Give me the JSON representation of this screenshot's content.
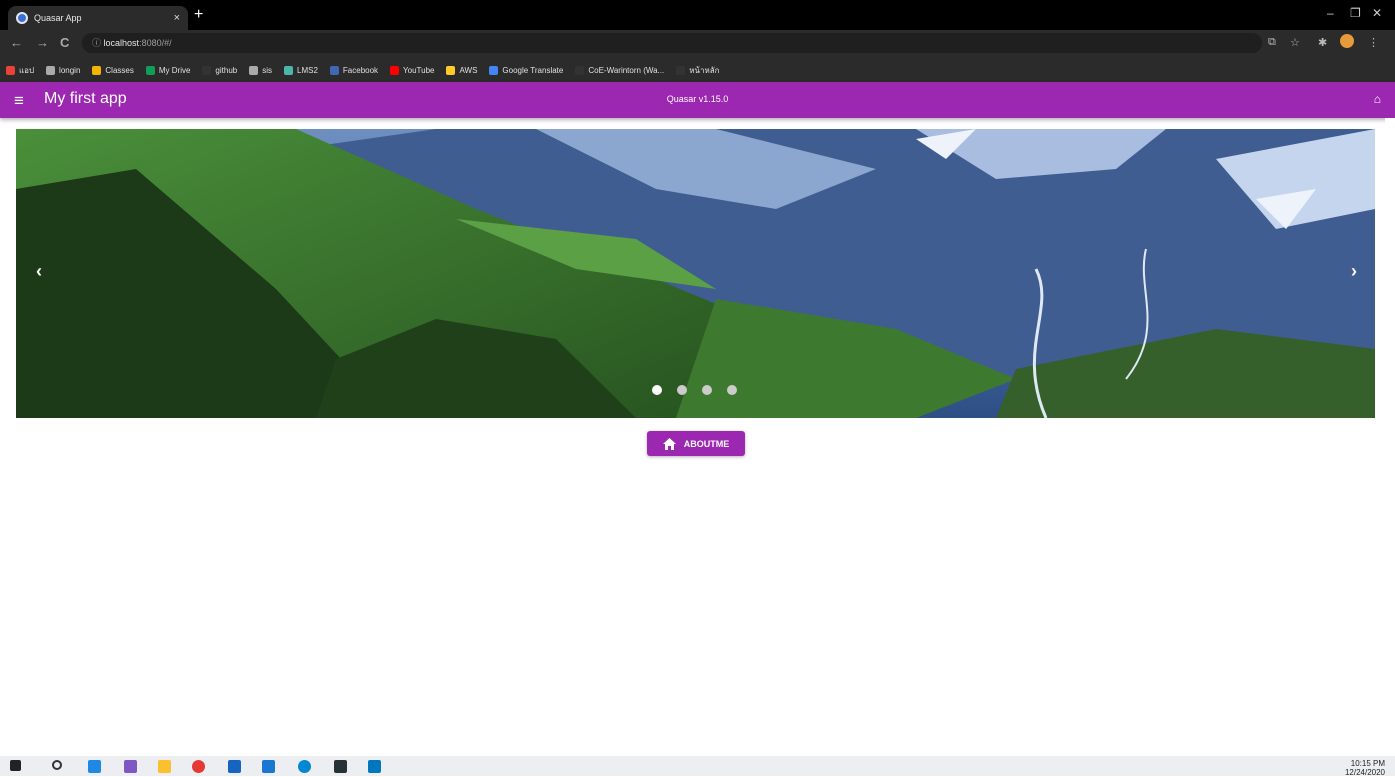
{
  "browser": {
    "tab_title": "Quasar App",
    "tab_close": "×",
    "new_tab": "+",
    "url_host": "localhost",
    "url_rest": ":8080/#/",
    "info": "ⓘ",
    "win_min": "–",
    "win_max": "❐",
    "win_close": "✕",
    "back": "←",
    "forward": "→",
    "reload": "C",
    "translate": "⧉",
    "star": "☆",
    "extensions": "✱",
    "more": "⋮",
    "bookmarks": [
      {
        "label": "แอป",
        "color": "#ea4335"
      },
      {
        "label": "longin",
        "color": "#aaaaaa"
      },
      {
        "label": "Classes",
        "color": "#f4b400"
      },
      {
        "label": "My Drive",
        "color": "#0f9d58"
      },
      {
        "label": "github",
        "color": "#333333"
      },
      {
        "label": "sis",
        "color": "#aaaaaa"
      },
      {
        "label": "LMS2",
        "color": "#4db6ac"
      },
      {
        "label": "Facebook",
        "color": "#4267b2"
      },
      {
        "label": "YouTube",
        "color": "#ff0000"
      },
      {
        "label": "AWS",
        "color": "#ffca28"
      },
      {
        "label": "Google Translate",
        "color": "#4285f4"
      },
      {
        "label": "CoE-Warintorn (Wa...",
        "color": "#333333"
      },
      {
        "label": "หน้าหลัก",
        "color": "#333333"
      }
    ]
  },
  "app": {
    "menu_icon": "≡",
    "title": "My first app",
    "version": "Quasar v1.15.0",
    "home_icon": "⌂",
    "accent": "#9c27b0"
  },
  "carousel": {
    "prev": "‹",
    "next": "›",
    "slides": 4,
    "active_slide": 1
  },
  "button": {
    "label": "ABOUTME",
    "icon": "home-icon"
  },
  "taskbar": {
    "time": "10:15 PM",
    "date": "12/24/2020"
  }
}
